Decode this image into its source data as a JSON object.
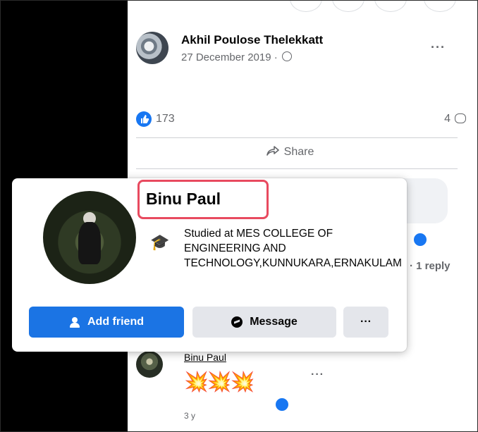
{
  "post": {
    "author": "Akhil Poulose Thelekkatt",
    "date": "27 December 2019 · ",
    "more_label": "···",
    "like_count": "173",
    "comment_count": "4",
    "share_label": "Share"
  },
  "comment": {
    "reply_label": "· 1 reply",
    "author": "Binu Paul",
    "emojis": "💥💥💥",
    "time": "3 y",
    "more_label": "···"
  },
  "hovercard": {
    "name": "Binu Paul",
    "education": "Studied at MES COLLEGE OF ENGINEERING AND TECHNOLOGY,KUNNUKARA,ERNAKULAM",
    "add_friend_label": "Add friend",
    "message_label": "Message",
    "more_label": "···",
    "highlight_color": "#e84a5f",
    "primary_color": "#1b74e4"
  },
  "icons": {
    "like": "thumbs-up-icon",
    "share": "share-arrow-icon",
    "education": "graduation-cap-icon",
    "privacy": "globe-icon",
    "comment": "comment-icon",
    "messenger": "messenger-icon",
    "add_friend": "add-person-icon"
  }
}
